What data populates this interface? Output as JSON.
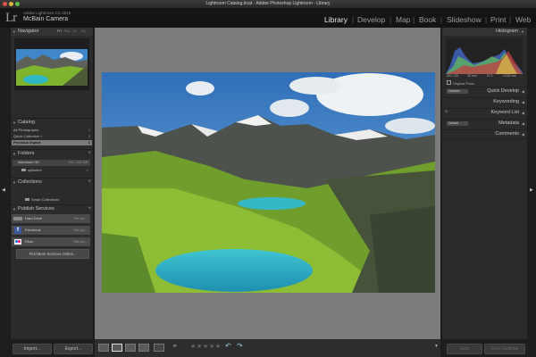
{
  "window": {
    "title": "Lightroom Catalog.lrcat - Adobe Photoshop Lightroom - Library"
  },
  "identity": {
    "logo": "Lr",
    "subtitle": "Adobe Lightroom CC 2015",
    "name": "McBain Camera"
  },
  "modules": [
    {
      "label": "Library",
      "active": true
    },
    {
      "label": "Develop",
      "active": false
    },
    {
      "label": "Map",
      "active": false
    },
    {
      "label": "Book",
      "active": false
    },
    {
      "label": "Slideshow",
      "active": false
    },
    {
      "label": "Print",
      "active": false
    },
    {
      "label": "Web",
      "active": false
    }
  ],
  "left": {
    "navigator": {
      "title": "Navigator",
      "zoom": [
        "FIT",
        "FILL",
        "1:1",
        "3:1"
      ]
    },
    "catalog": {
      "title": "Catalog",
      "items": [
        {
          "label": "All Photographs",
          "count": "1"
        },
        {
          "label": "Quick Collection +",
          "count": "0"
        },
        {
          "label": "Previous Import",
          "count": "1"
        }
      ]
    },
    "folders": {
      "title": "Folders",
      "volume": "Macintosh HD",
      "volume_size": "9/1 / 105 GB",
      "folder": "splitshire",
      "folder_count": "1"
    },
    "collections": {
      "title": "Collections",
      "smart": "Smart Collections"
    },
    "publish": {
      "title": "Publish Services",
      "services": [
        {
          "name": "Hard Drive",
          "setup": "Set Up..."
        },
        {
          "name": "Facebook",
          "setup": "Set Up..."
        },
        {
          "name": "Flickr",
          "setup": "Set Up..."
        }
      ],
      "find_more": "Find More Services Online..."
    }
  },
  "right": {
    "histogram": {
      "title": "Histogram",
      "readout": [
        "ISO 125",
        "35 mm",
        "f/7.1",
        "1/250 sec"
      ],
      "original": "Original Photo"
    },
    "panels": [
      {
        "label": "Quick Develop",
        "dropdown": "Defaults"
      },
      {
        "label": "Keywording",
        "dropdown": ""
      },
      {
        "label": "Keyword List",
        "dropdown": ""
      },
      {
        "label": "Metadata",
        "dropdown": "Default"
      },
      {
        "label": "Comments",
        "dropdown": ""
      }
    ]
  },
  "bottom": {
    "import_label": "Import...",
    "export_label": "Export...",
    "sync_label": "Sync",
    "sync_settings_label": "Sync Settings"
  },
  "colors": {
    "accent_active": "#e6e6e6",
    "inactive": "#9d9d9d",
    "sky": "#3f87c9",
    "lake": "#2fb6c7",
    "grass": "#7fb52e"
  }
}
